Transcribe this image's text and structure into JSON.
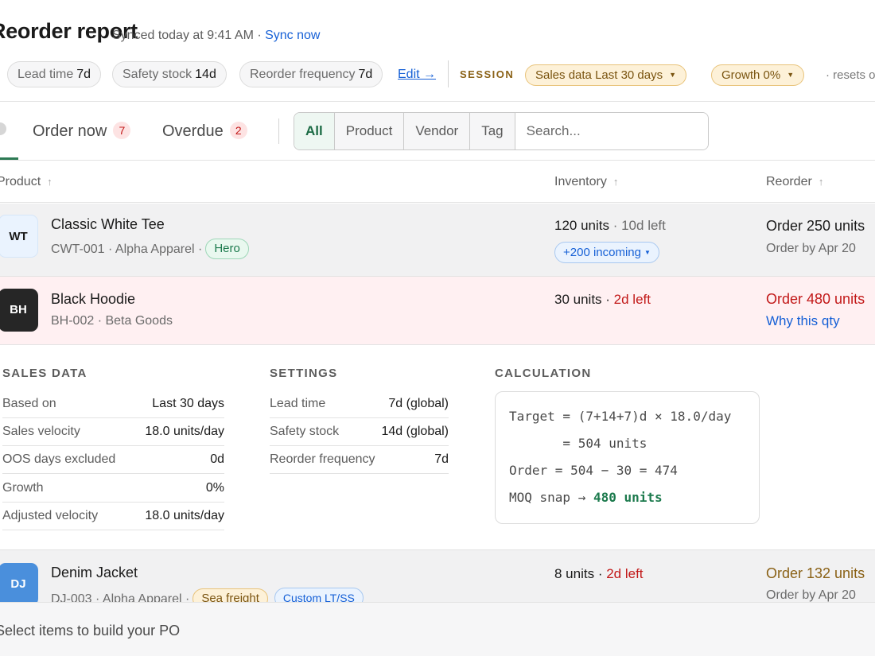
{
  "header": {
    "title": "Reorder report",
    "synced": "Synced today at 9:41 AM",
    "sync_sep": " · ",
    "sync_link": "Sync now",
    "global_settings": [
      {
        "label": "Lead time",
        "value": "7d"
      },
      {
        "label": "Safety stock",
        "value": "14d"
      },
      {
        "label": "Reorder frequency",
        "value": "7d"
      }
    ],
    "edit_link": "Edit →",
    "session_label": "SESSION",
    "session_settings": [
      {
        "label": "Sales data",
        "value": "Last 30 days"
      },
      {
        "label": "Growth",
        "value": "0%"
      }
    ],
    "resets_text": "· resets on"
  },
  "tabs": [
    {
      "label": "Order now",
      "count": "7"
    },
    {
      "label": "Overdue",
      "count": "2"
    }
  ],
  "filter": {
    "buttons": [
      "All",
      "Product",
      "Vendor",
      "Tag"
    ],
    "search_placeholder": "Search..."
  },
  "table": {
    "columns": {
      "product": "Product",
      "inventory": "Inventory",
      "reorder": "Reorder"
    },
    "sort_arrow": "↑",
    "rows": [
      {
        "initials": "WT",
        "name": "Classic White Tee",
        "sub": "CWT-001 · Alpha Apparel ·",
        "tags": [
          "Hero"
        ],
        "inventory": "120 units",
        "inventory_note": " · 10d left",
        "incoming": "+200 incoming",
        "reorder": "Order 250 units",
        "reorder_sub": "Order by Apr 20"
      },
      {
        "initials": "BH",
        "name": "Black Hoodie",
        "sub": "BH-002 · Beta Goods",
        "inventory": "30 units",
        "inventory_sep": " · ",
        "inventory_note": "2d left",
        "reorder": "Order 480 units",
        "reorder_link": "Why this qty"
      },
      {
        "initials": "DJ",
        "name": "Denim Jacket",
        "sub": "DJ-003 · Alpha Apparel ·",
        "tags": [
          "Sea freight",
          "Custom LT/SS"
        ],
        "inventory": "8 units",
        "inventory_sep": " · ",
        "inventory_note": "2d left",
        "reorder": "Order 132 units",
        "reorder_sub": "Order by Apr 20"
      }
    ]
  },
  "detail": {
    "sales_data": {
      "heading": "SALES DATA",
      "rows": [
        {
          "k": "Based on",
          "v": "Last 30 days"
        },
        {
          "k": "Sales velocity",
          "v": "18.0 units/day"
        },
        {
          "k": "OOS days excluded",
          "v": "0d"
        },
        {
          "k": "Growth",
          "v": "0%"
        },
        {
          "k": "Adjusted velocity",
          "v": "18.0 units/day"
        }
      ]
    },
    "settings": {
      "heading": "SETTINGS",
      "rows": [
        {
          "k": "Lead time",
          "v": "7d (global)"
        },
        {
          "k": "Safety stock",
          "v": "14d (global)"
        },
        {
          "k": "Reorder frequency",
          "v": "7d"
        }
      ]
    },
    "calculation": {
      "heading": "CALCULATION",
      "line1": "Target = (7+14+7)d × 18.0/day",
      "line2": "       = 504 units",
      "line3": "Order = 504 − 30 = 474",
      "line4_prefix": "MOQ snap → ",
      "line4_value": "480 units"
    }
  },
  "footer": {
    "text": "Select items to build your PO"
  },
  "colors": {
    "accent": "#2d7a54",
    "danger": "#c21818",
    "link": "#1660d6",
    "session": "#8a6116",
    "row_alert_bg": "#fff0f2",
    "row_selected_bg": "#f1f1f2"
  }
}
